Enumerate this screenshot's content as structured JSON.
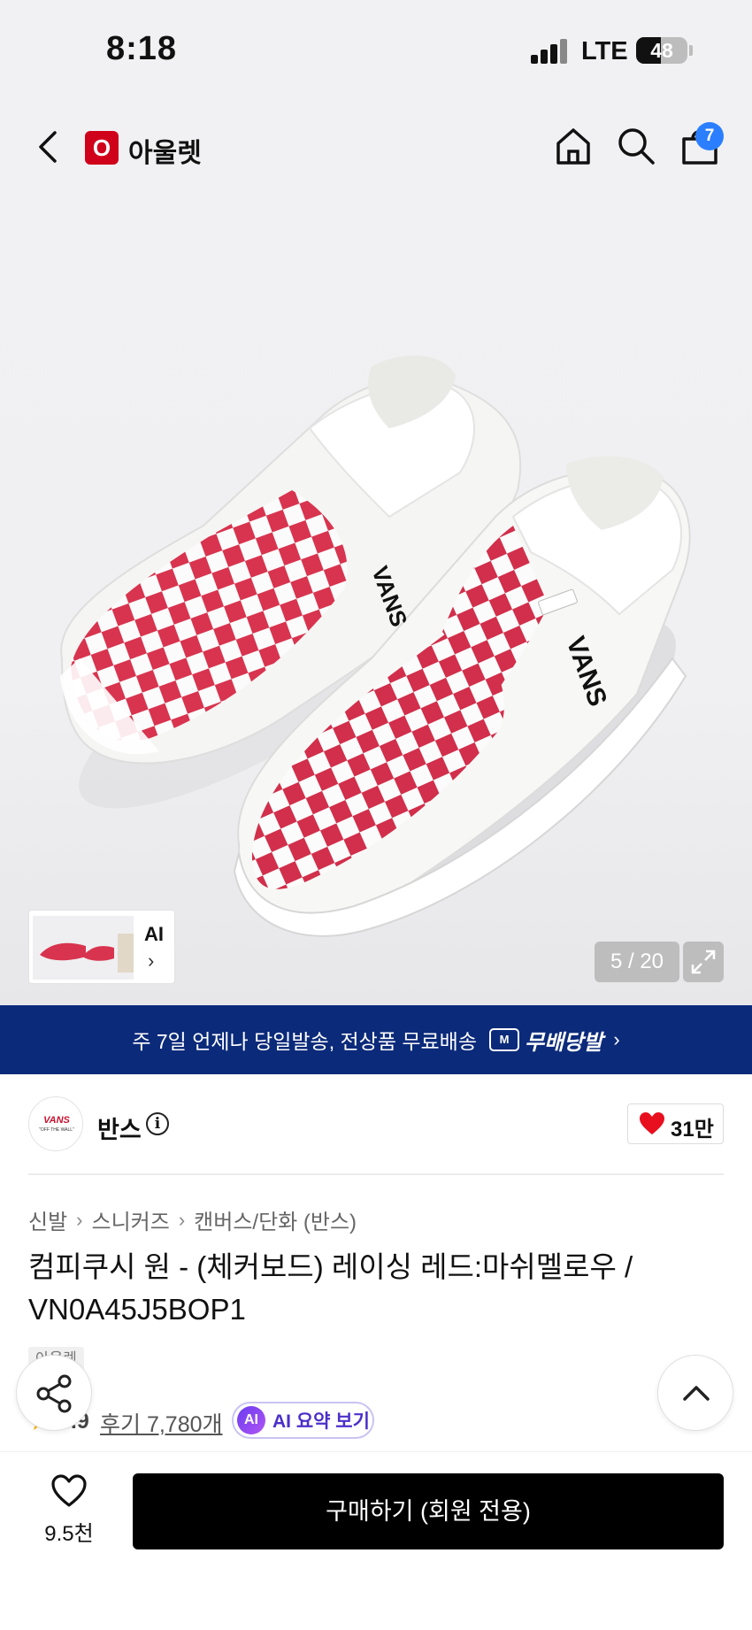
{
  "status_bar": {
    "time": "8:18",
    "network": "LTE",
    "battery": "48",
    "battery_level": 0.48
  },
  "header": {
    "logo_letter": "O",
    "title": "아울렛",
    "cart_count": "7",
    "icons": [
      "back-icon",
      "home-icon",
      "search-icon",
      "cart-icon"
    ]
  },
  "gallery": {
    "thumb_label": "AI",
    "thumb_chevron": "›",
    "counter": "5 / 20"
  },
  "banner": {
    "text": "주 7일 언제나 당일발송, 전상품 무료배송",
    "truck_label": "M",
    "badge": "무배당발",
    "chevron": "›"
  },
  "brand": {
    "logo_text": "VANS",
    "logo_sub": "\"OFF THE WALL\"",
    "name": "반스",
    "info": "i",
    "likes": "31만"
  },
  "breadcrumb": [
    "신발",
    "스니커즈",
    "캔버스/단화 (반스)"
  ],
  "breadcrumb_sep": "›",
  "product": {
    "title": "컴피쿠시 원 - (체커보드) 레이싱 레드:마쉬멜로우 / VN0A45J5BOP1",
    "tag": "아울렛",
    "rating_star": "★",
    "rating": "4.9",
    "reviews": "후기 7,780개",
    "ai_badge": "AI",
    "ai_summary": "AI 요약 보기"
  },
  "bottom_bar": {
    "wish_count": "9.5천",
    "buy_label": "구매하기 (회원 전용)"
  },
  "colors": {
    "brand_red": "#d0021b",
    "banner_navy": "#0b2a7a",
    "checker_red": "#d8344f",
    "ai_purple": "#4b2fc9",
    "cart_badge": "#2b7fff"
  }
}
